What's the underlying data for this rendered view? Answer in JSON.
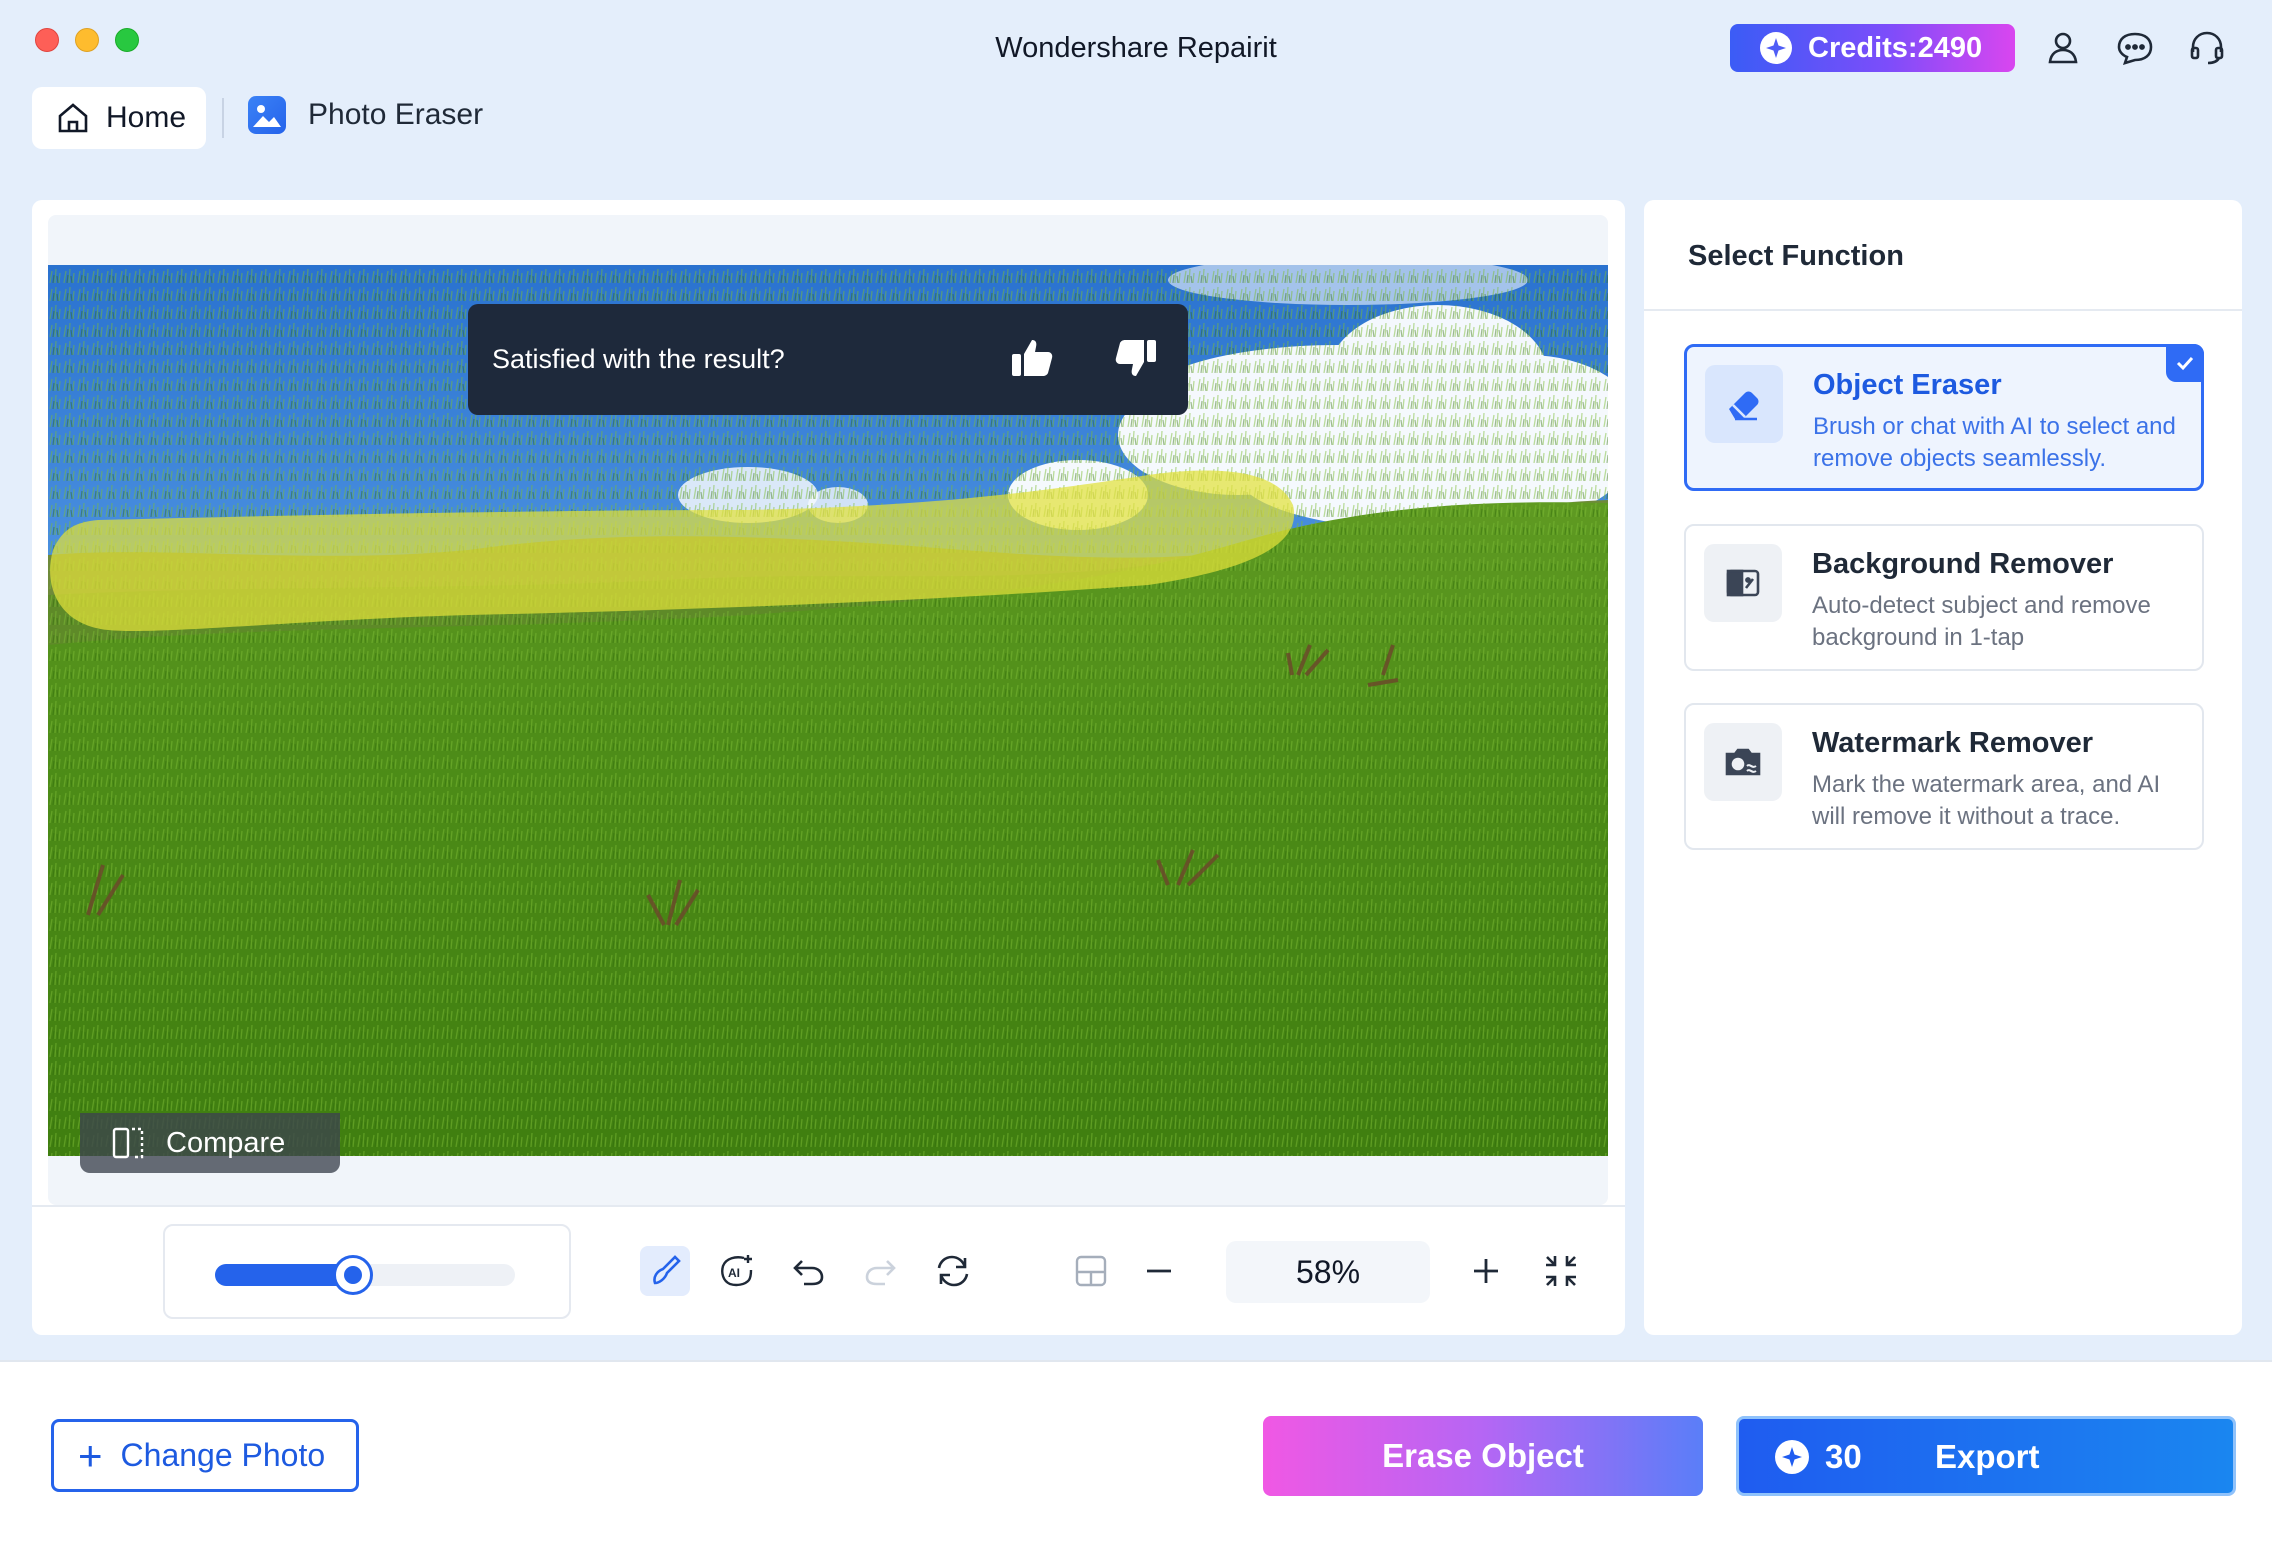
{
  "window": {
    "title": "Wondershare Repairit"
  },
  "header": {
    "credits_label": "Credits:2490"
  },
  "nav": {
    "home_label": "Home",
    "current_tab_label": "Photo Eraser"
  },
  "editor": {
    "feedback_prompt": "Satisfied with the result?",
    "compare_label": "Compare",
    "brush_size_percent": 46,
    "zoom_level": "58%"
  },
  "side_panel": {
    "title": "Select Function",
    "functions": [
      {
        "title": "Object Eraser",
        "description": "Brush or chat with AI to select and remove objects seamlessly.",
        "selected": true,
        "icon": "eraser-icon"
      },
      {
        "title": "Background Remover",
        "description": "Auto-detect subject and remove background in 1-tap",
        "selected": false,
        "icon": "background-remove-icon"
      },
      {
        "title": "Watermark Remover",
        "description": "Mark the watermark area, and AI will remove it without a trace.",
        "selected": false,
        "icon": "watermark-icon"
      }
    ]
  },
  "footer": {
    "change_photo_label": "Change Photo",
    "erase_label": "Erase Object",
    "export_cost": "30",
    "export_label": "Export"
  },
  "colors": {
    "accent": "#2563eb",
    "background": "#e4eefb",
    "feedback_bg": "#1e293b",
    "brush_highlight": "#e2e03a"
  }
}
